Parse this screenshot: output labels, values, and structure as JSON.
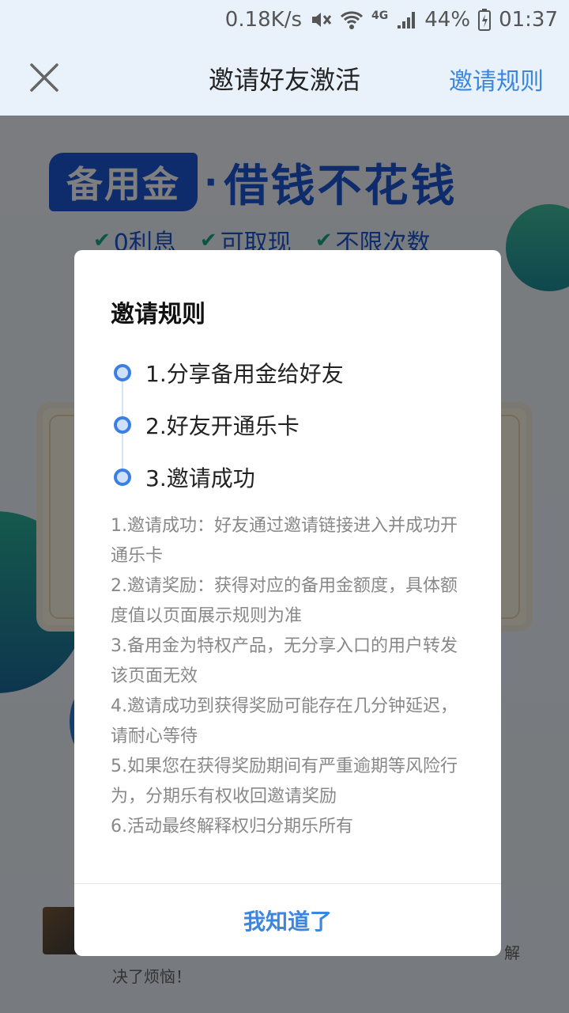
{
  "status_bar": {
    "net_speed": "0.18K/s",
    "network_type": "4G",
    "battery": "44%",
    "time": "01:37",
    "icons": [
      "mute-icon",
      "wifi-icon",
      "signal-icon",
      "battery-icon"
    ]
  },
  "nav": {
    "title": "邀请好友激活",
    "rules_link": "邀请规则",
    "close_icon": "close-icon"
  },
  "background": {
    "brand_badge": "备用金",
    "brand_dot": "·",
    "brand_slogan": "借钱不花钱",
    "features": [
      "0利息",
      "可取现",
      "不限次数"
    ],
    "comment_tail": "解",
    "comment_line2": "决了烦恼！"
  },
  "modal": {
    "title": "邀请规则",
    "steps": [
      "1.分享备用金给好友",
      "2.好友开通乐卡",
      "3.邀请成功"
    ],
    "rules": [
      "1.邀请成功：好友通过邀请链接进入并成功开通乐卡",
      "2.邀请奖励：获得对应的备用金额度，具体额度值以页面展示规则为准",
      "3.备用金为特权产品，无分享入口的用户转发该页面无效",
      "4.邀请成功到获得奖励可能存在几分钟延迟，请耐心等待",
      "5.如果您在获得奖励期间有严重逾期等风险行为，分期乐有权收回邀请奖励",
      "6.活动最终解释权归分期乐所有"
    ],
    "confirm_label": "我知道了"
  },
  "colors": {
    "accent": "#3b87e0",
    "brand_blue": "#1d57d6",
    "check_green": "#19a98a"
  }
}
